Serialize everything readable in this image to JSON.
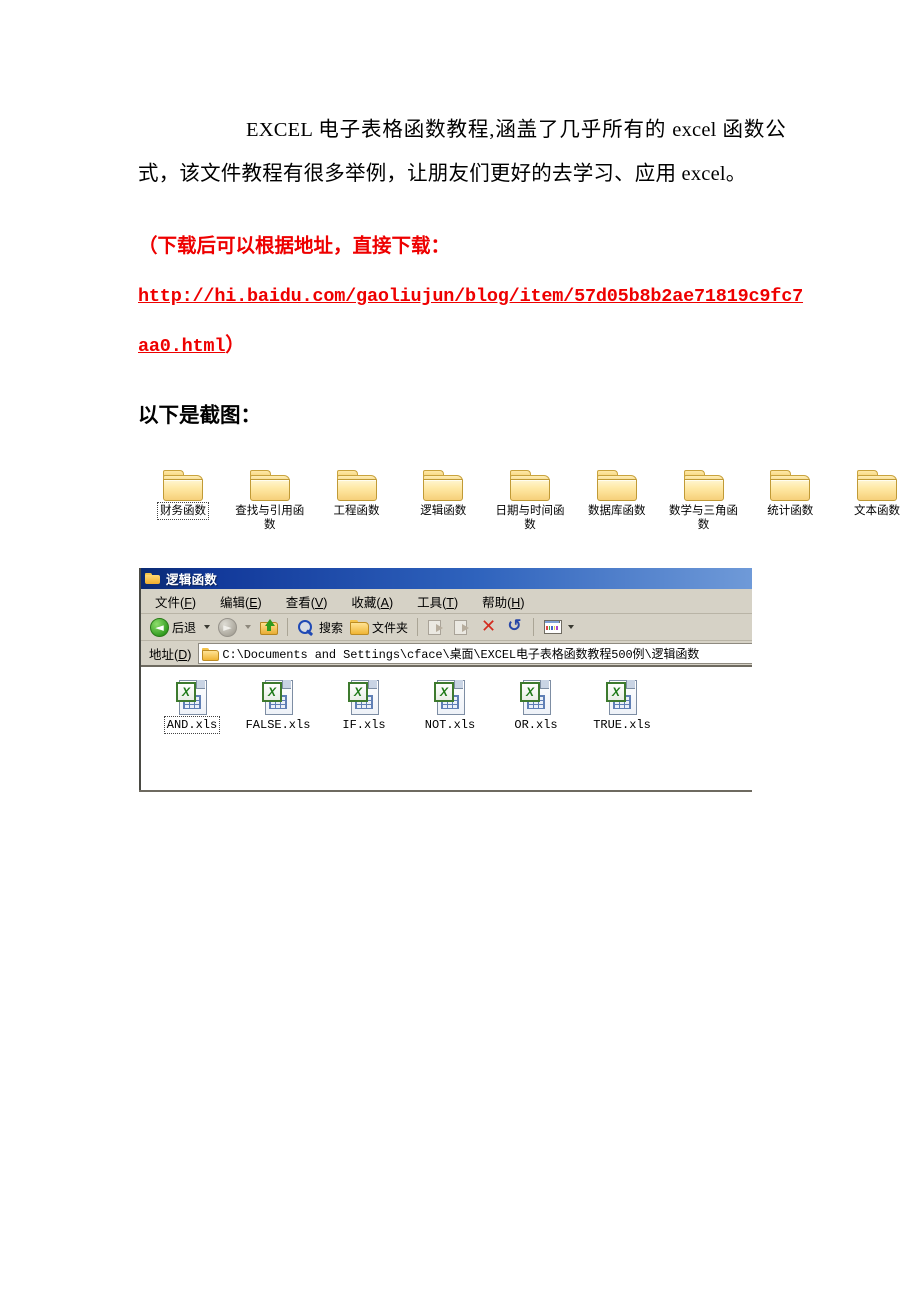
{
  "document": {
    "paragraph1_part1": "EXCEL 电子表格函数教程,涵盖了几乎所有的 excel 函数公",
    "paragraph1_part2": "式，该文件教程有很多举例，让朋友们更好的去学习、应用 excel。",
    "red_note_line1": "（下载后可以根据地址，直接下载：",
    "url_line1": "http://hi.baidu.com/gaoliujun/blog/item/57d05b8b2ae71819c9fc7",
    "url_line2": "aa0.html",
    "url_closing_paren": "）",
    "section_title": "以下是截图：",
    "red_color": "#ee0000"
  },
  "folders": {
    "items": [
      {
        "label": "财务函数",
        "selected": true
      },
      {
        "label": "查找与引用函数",
        "selected": false
      },
      {
        "label": "工程函数",
        "selected": false
      },
      {
        "label": "逻辑函数",
        "selected": false
      },
      {
        "label": "日期与时间函数",
        "selected": false
      },
      {
        "label": "数据库函数",
        "selected": false
      },
      {
        "label": "数学与三角函数",
        "selected": false
      },
      {
        "label": "统计函数",
        "selected": false
      },
      {
        "label": "文本函数",
        "selected": false
      }
    ]
  },
  "explorer": {
    "title": "逻辑函数",
    "title_bar_color": "#12399a",
    "menu": [
      {
        "label": "文件",
        "accel": "F"
      },
      {
        "label": "编辑",
        "accel": "E"
      },
      {
        "label": "查看",
        "accel": "V"
      },
      {
        "label": "收藏",
        "accel": "A"
      },
      {
        "label": "工具",
        "accel": "T"
      },
      {
        "label": "帮助",
        "accel": "H"
      }
    ],
    "toolbar": {
      "back_label": "后退",
      "search_label": "搜索",
      "folders_label": "文件夹"
    },
    "address": {
      "label": "地址",
      "accel": "D",
      "path": "C:\\Documents and Settings\\cface\\桌面\\EXCEL电子表格函数教程500例\\逻辑函数"
    },
    "files": [
      {
        "name": "AND.xls",
        "selected": true
      },
      {
        "name": "FALSE.xls",
        "selected": false
      },
      {
        "name": "IF.xls",
        "selected": false
      },
      {
        "name": "NOT.xls",
        "selected": false
      },
      {
        "name": "OR.xls",
        "selected": false
      },
      {
        "name": "TRUE.xls",
        "selected": false
      }
    ],
    "excel_badge_letter": "X",
    "delete_glyph": "✕",
    "undo_glyph": "↺"
  }
}
